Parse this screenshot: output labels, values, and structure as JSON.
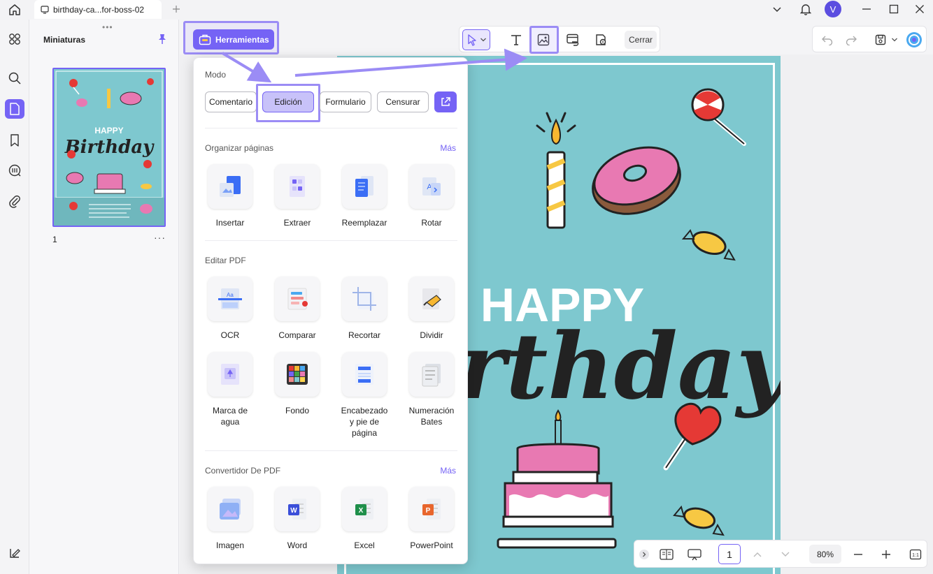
{
  "window": {
    "tab_title": "birthday-ca...for-boss-02",
    "avatar_letter": "V",
    "accent": "#7563f5"
  },
  "rail": {
    "icons": [
      "apps-icon",
      "search-icon",
      "pages-icon",
      "bookmark-icon",
      "comment-list-icon",
      "attachment-icon",
      "layers-icon"
    ],
    "active": "pages-icon"
  },
  "thumbnails": {
    "title": "Miniaturas",
    "pages": [
      {
        "number": "1"
      }
    ]
  },
  "toolbar": {
    "tools_label": "Herramientas",
    "close_label": "Cerrar"
  },
  "popup": {
    "mode_title": "Modo",
    "modes": [
      "Comentario",
      "Edición",
      "Formulario",
      "Censurar"
    ],
    "selected_mode": "Edición",
    "organize": {
      "title": "Organizar páginas",
      "more": "Más",
      "items": [
        "Insertar",
        "Extraer",
        "Reemplazar",
        "Rotar"
      ]
    },
    "edit": {
      "title": "Editar PDF",
      "items": [
        "OCR",
        "Comparar",
        "Recortar",
        "Dividir",
        "Marca de agua",
        "Fondo",
        "Encabezado y pie de página",
        "Numeración Bates"
      ]
    },
    "convert": {
      "title": "Convertidor De PDF",
      "more": "Más",
      "items": [
        "Imagen",
        "Word",
        "Excel",
        "PowerPoint"
      ]
    }
  },
  "document": {
    "headline": "HAPPY",
    "script_text": "Birthday"
  },
  "bottom_nav": {
    "page": "1",
    "zoom": "80%",
    "fit_label": "1:1"
  }
}
